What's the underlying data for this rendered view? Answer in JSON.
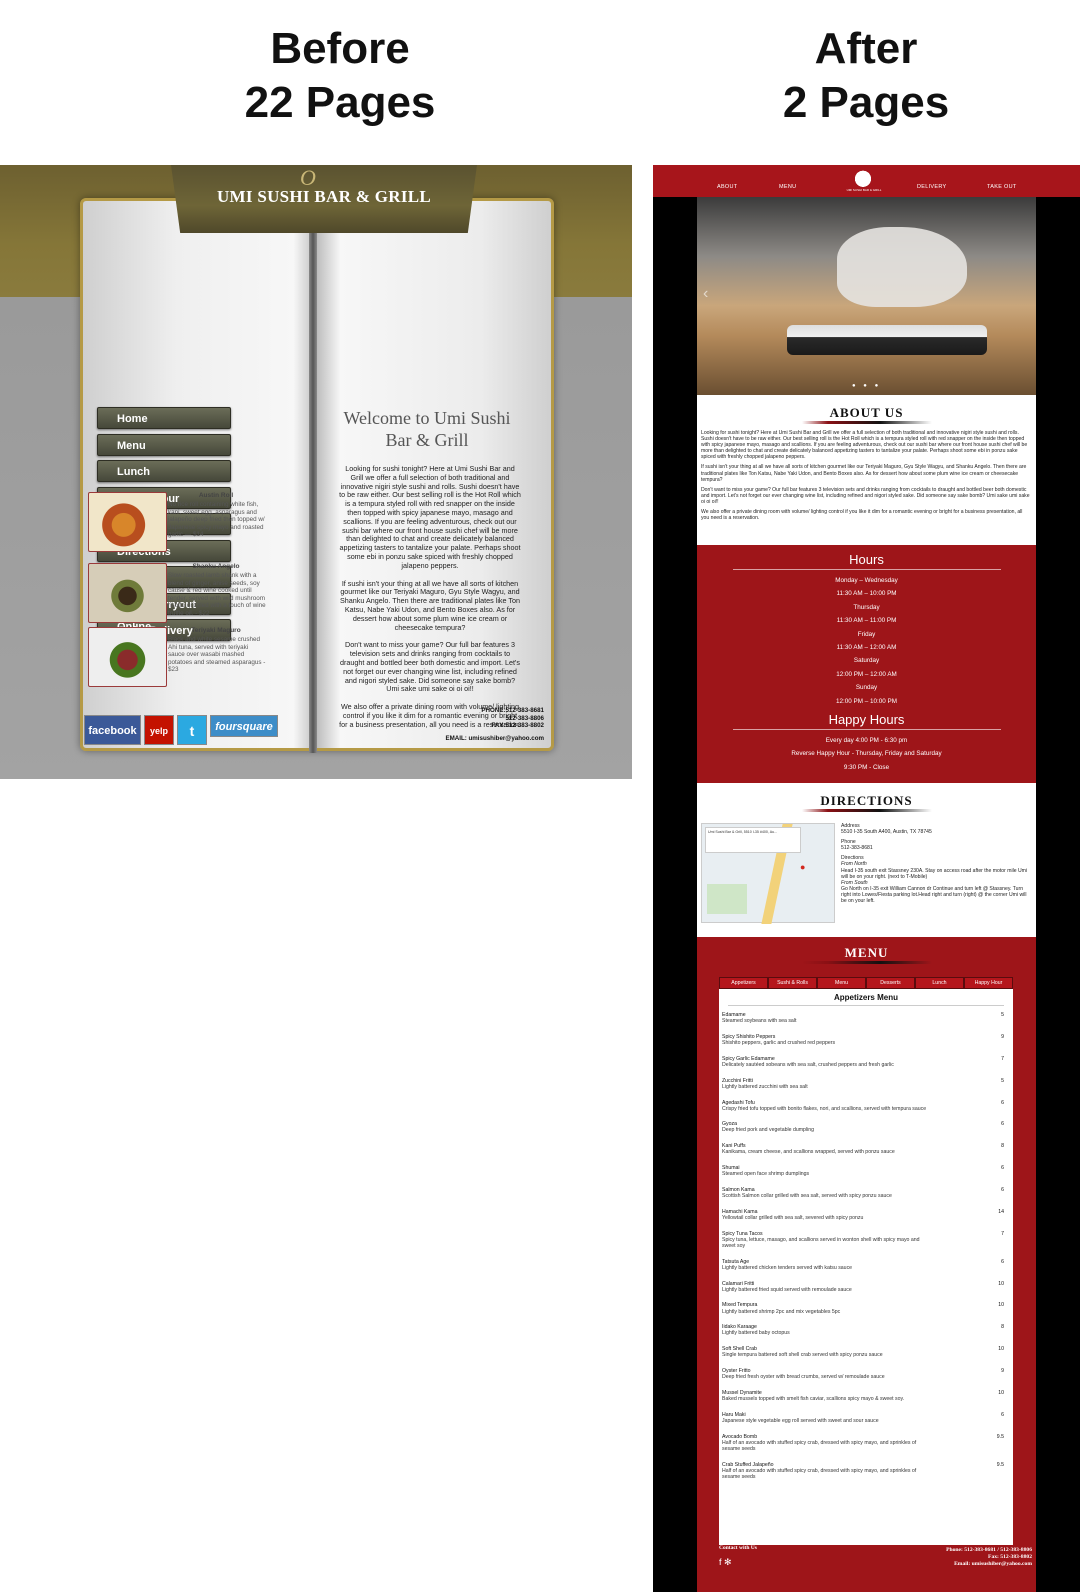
{
  "headings": {
    "before": [
      "Before",
      "22 Pages"
    ],
    "after": [
      "After",
      "2 Pages"
    ]
  },
  "before": {
    "banner_title": "UMI SUSHI BAR & GRILL",
    "banner_ornament": "O",
    "nav": [
      "Home",
      "Menu",
      "Lunch",
      "Happy Hour",
      "About Us",
      "Directions",
      "Gift Card",
      "Order Carryout Online",
      "Order Delivery Online"
    ],
    "dishes": [
      {
        "name": "Austin Roll",
        "desc": "No rice roll containing white fish, kani, sweet egg, asparagus and jalapeño deep fried then topped w/ Japanese spicy mayo and roasted garlic — $14"
      },
      {
        "name": "Shanku Angelo",
        "desc": "Slow roasted lamb shank with a blend of ginger, anise seeds, soy cause & red wine cooked until tender, served with wild mushroom risotto drizzled with a touch of wine truffle oil. - $22"
      },
      {
        "name": "Teriyaki Maguro",
        "desc": "Black and white sesame crushed Ahi tuna, served with teriyaki sauce over wasabi mashed potatoes and steamed asparagus - $23"
      }
    ],
    "social": {
      "facebook": "facebook",
      "yelp": "yelp",
      "twitter": "t",
      "foursquare": "foursquare"
    },
    "welcome_title": "Welcome to Umi Sushi Bar & Grill",
    "welcome_paragraphs": [
      "Looking for sushi tonight? Here at Umi Sushi Bar and Grill we offer a full selection of both traditional and innovative nigiri style sushi and rolls. Sushi doesn't have to be raw either. Our best selling roll is the Hot Roll which is a tempura styled roll with red snapper on the inside then topped with spicy japanese mayo, masago and scallions. If you are feeling adventurous, check out our sushi bar where our front house sushi chef will be more than delighted to chat and create delicately balanced appetizing tasters to tantalize your palate. Perhaps shoot some ebi in ponzu sake spiced with freshly chopped jalapeno peppers.",
      "If sushi isn't your thing at all we have all sorts of kitchen gourmet like our Teriyaki Maguro, Gyu Style Wagyu, and Shanku Angelo. Then there are traditional plates like Ton Katsu, Nabe Yaki Udon, and Bento Boxes also. As for dessert how about some plum wine ice cream or cheesecake tempura?",
      "Don't want to miss your game? Our full bar features 3 television sets and drinks ranging from cocktails to draught and bottled beer both domestic and import. Let's not forget our ever changing wine list, including refined and nigori styled sake. Did someone say sake bomb? Umi sake umi sake oi oi oi!!",
      "We also offer a private dining room with volume/ lighting control if you like it dim for a romantic evening or bright for a business presentation, all you need is a reservation."
    ],
    "contact_lines": [
      "PHONE:512-383-8681",
      "512-383-8806",
      "FAX:512-383-8802"
    ],
    "email": "EMAIL: umisushiber@yahoo.com"
  },
  "after": {
    "nav": [
      "ABOUT",
      "MENU",
      "DELIVERY",
      "TAKE OUT"
    ],
    "logo_text": "UMI SUSHI BAR & GRILL",
    "hero_arrow": "‹",
    "hero_dots": "● ● ●",
    "about_title": "ABOUT US",
    "about_paragraphs": [
      "Looking for sushi tonight? Here at Umi Sushi Bar and Grill we offer a full selection of both traditional and innovative nigiri style sushi and rolls. Sushi doesn't have to be raw either. Our best selling roll is the Hot Roll which is a tempura styled roll with red snapper on the inside then topped with spicy japanese mayo, masago and scallions. If you are feeling adventurous, check out our sushi bar where our front house sushi chef will be more than delighted to chat and create delicately balanced appetizing tasters to tantalize your palate. Perhaps shoot some ebi in ponzu sake spiced with freshly chopped jalapeno peppers.",
      "If sushi isn't your thing at all we have all sorts of kitchen gourmet like our Teriyaki Maguro, Gyu Style Wagyu, and Shanku Angelo. Then there are traditional plates like Ton Katsu, Nabe Yaki Udon, and Bento Boxes also. As for dessert how about some plum wine ice cream or cheesecake tempura?",
      "Don't want to miss your game? Our full bar features 3 television sets and drinks ranging from cocktails to draught and bottled beer both domestic and import. Let's not forget our ever changing wine list, including refined and nigori styled sake. Did someone say sake bomb? Umi sake umi sake oi oi oi!!",
      "We also offer a private dining room with volume/ lighting control if you like it dim for a romantic evening or bright for a business presentation, all you need is a reservation."
    ],
    "hours_title": "Hours",
    "hours": [
      "Monday – Wednesday",
      "11:30 AM – 10:00 PM",
      "Thursday",
      "11:30 AM – 11:00 PM",
      "Friday",
      "11:30 AM – 12:00 AM",
      "Saturday",
      "12:00 PM – 12:00 AM",
      "Sunday",
      "12:00 PM – 10:00 PM"
    ],
    "happy_title": "Happy Hours",
    "happy": [
      "Every day 4:00 PM - 6:30 pm",
      "Reverse Happy Hour - Thursday, Friday and Saturday",
      "9:30 PM - Close"
    ],
    "directions_title": "DIRECTIONS",
    "map_info": "Umi Sushi Bar & Grill, 5510 I-35 #400, Au...",
    "address_label": "Address",
    "address": "5510 I-35 South A400, Austin, TX 78745",
    "phone_label": "Phone",
    "phone": "512-383-8681",
    "directions_label": "Directions",
    "from_north_label": "From North",
    "from_north": "Head I-35 south exit Stassney 230A. Stay on access road after the motor mile Umi will be on your right. (next to T-Mobile)",
    "from_south_label": "From South",
    "from_south": "Go North on I-35 exit William Cannon dr Continue and turn left @ Stassney. Turn right into Lowes/Fiesta parking lot.Head right and turn (right) @ the corner Umi will be on your left.",
    "menu_title": "MENU",
    "menu_tabs": [
      "Appetizers",
      "Sushi & Rolls",
      "Menu",
      "Desserts",
      "Lunch",
      "Happy Hour"
    ],
    "menu_panel_title": "Appetizers Menu",
    "menu_items": [
      {
        "name": "Edamame",
        "desc": "Steamed soybeans with sea salt",
        "price": "5"
      },
      {
        "name": "Spicy Shishito Peppers",
        "desc": "Shishito peppers, garlic and crushed red peppers",
        "price": "9"
      },
      {
        "name": "Spicy Garlic Edamame",
        "desc": "Delicately sautéed sobeans with sea salt, crushed peppers and fresh garlic",
        "price": "7"
      },
      {
        "name": "Zucchini Fritti",
        "desc": "Lightly battered zucchini with sea salt",
        "price": "5"
      },
      {
        "name": "Agedashi Tofu",
        "desc": "Crispy fried tofu topped with bonito flakes, nori, and scallions, served with tempura sauce",
        "price": "6"
      },
      {
        "name": "Gyoza",
        "desc": "Deep fried pork and vegetable dumpling",
        "price": "6"
      },
      {
        "name": "Kani Puffs",
        "desc": "Kanikama, cream cheese, and scallions wrapped, served with ponzu sauce",
        "price": "8"
      },
      {
        "name": "Shumai",
        "desc": "Steamed open face shrimp dumplings",
        "price": "6"
      },
      {
        "name": "Salmon Kama",
        "desc": "Scottish Salmon collar grilled with sea salt, served with spicy ponzu sauce",
        "price": "6"
      },
      {
        "name": "Hamachi Kama",
        "desc": "Yellowtail collar grilled with sea salt, severed with spicy ponzu",
        "price": "14"
      },
      {
        "name": "Spicy Tuna Tacos",
        "desc": "Spicy tuna, lettuce, masago, and scallions served in wonton shell with spicy mayo and sweet soy",
        "price": "7"
      },
      {
        "name": "Tatsuta Age",
        "desc": "Lightly battered chicken tenders served with katsu sauce",
        "price": "6"
      },
      {
        "name": "Calamari Fritti",
        "desc": "Lightly battered fried squid served with remoulade sauce",
        "price": "10"
      },
      {
        "name": "Mixed Tempura",
        "desc": "Lightly battered shrimp 2pc and mix vegetables 5pc",
        "price": "10"
      },
      {
        "name": "Iidako Karaage",
        "desc": "Lightly battered baby octopus",
        "price": "8"
      },
      {
        "name": "Soft Shell Crab",
        "desc": "Single tempura battered soft shell crab served with spicy ponzu sauce",
        "price": "10"
      },
      {
        "name": "Oyster Fritto",
        "desc": "Deep fried fresh oyster with bread crumbs, served w/ remoulade sauce",
        "price": "9"
      },
      {
        "name": "Mussel Dynamite",
        "desc": "Baked mussels topped with smelt fish caviar, scallions spicy mayo & sweet soy.",
        "price": "10"
      },
      {
        "name": "Haru Maki",
        "desc": "Japanese style vegetable egg roll served with sweet and sour sauce",
        "price": "6"
      },
      {
        "name": "Avocado Bomb",
        "desc": "Half of an avocado with stuffed spicy crab, dressed with spicy mayo, and sprinkles of sesame seeds",
        "price": "9.5"
      },
      {
        "name": "Crab Stuffed Jalapeño",
        "desc": "Half of an avocado with stuffed spicy crab, dressed with spicy mayo, and sprinkles of sesame seeds",
        "price": "9.5"
      }
    ],
    "footer_contact": "Contact with Us",
    "footer_icons": "f ✻",
    "footer_phone": [
      "Phone: 512-383-8681 / 512-383-8806",
      "Fax: 512-383-8802",
      "Email: umisushiber@yahoo.com"
    ]
  }
}
